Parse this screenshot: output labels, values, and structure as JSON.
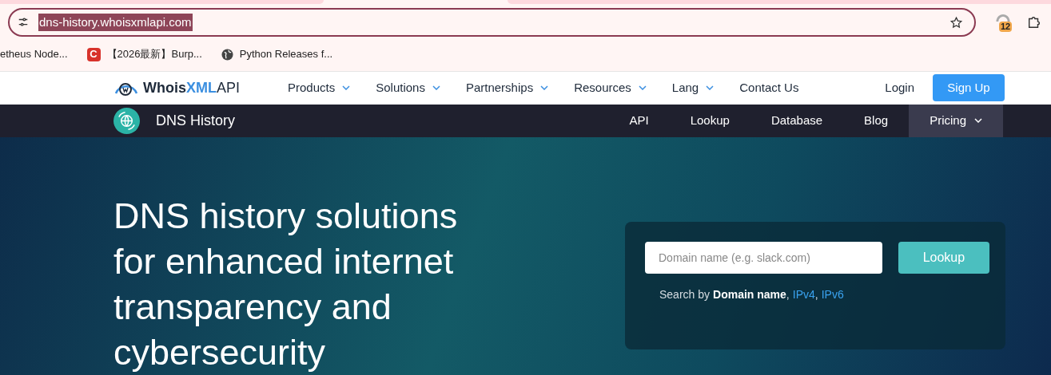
{
  "browser": {
    "url": {
      "text": "dns-history.whoisxmlapi.com",
      "selected": true
    },
    "extension_badge": "12",
    "bookmarks": [
      {
        "kind": "none",
        "label": "etheus Node..."
      },
      {
        "kind": "letter",
        "icon_text": "C",
        "label": "【2026最新】Burp..."
      },
      {
        "kind": "globe",
        "label": "Python Releases f..."
      }
    ]
  },
  "site_header": {
    "logo": {
      "bold": "Whois",
      "accent": "XML",
      "rest": "API"
    },
    "menu": [
      {
        "label": "Products",
        "dropdown": true
      },
      {
        "label": "Solutions",
        "dropdown": true
      },
      {
        "label": "Partnerships",
        "dropdown": true
      },
      {
        "label": "Resources",
        "dropdown": true
      },
      {
        "label": "Lang",
        "dropdown": true
      },
      {
        "label": "Contact Us",
        "dropdown": false
      }
    ],
    "login": "Login",
    "signup": "Sign Up"
  },
  "product_nav": {
    "title": "DNS History",
    "items": [
      {
        "label": "API",
        "selected": false,
        "dropdown": false
      },
      {
        "label": "Lookup",
        "selected": false,
        "dropdown": false
      },
      {
        "label": "Database",
        "selected": false,
        "dropdown": false
      },
      {
        "label": "Blog",
        "selected": false,
        "dropdown": false
      },
      {
        "label": "Pricing",
        "selected": true,
        "dropdown": true
      }
    ]
  },
  "hero": {
    "heading_lines": [
      "DNS history solutions",
      "for enhanced internet",
      "transparency and",
      "cybersecurity"
    ],
    "search": {
      "placeholder": "Domain name (e.g. slack.com)",
      "button": "Lookup",
      "search_by": "Search by",
      "separator": ",",
      "options": [
        {
          "label": "Domain name",
          "selected": true
        },
        {
          "label": "IPv4",
          "selected": false
        },
        {
          "label": "IPv6",
          "selected": false
        }
      ]
    }
  }
}
